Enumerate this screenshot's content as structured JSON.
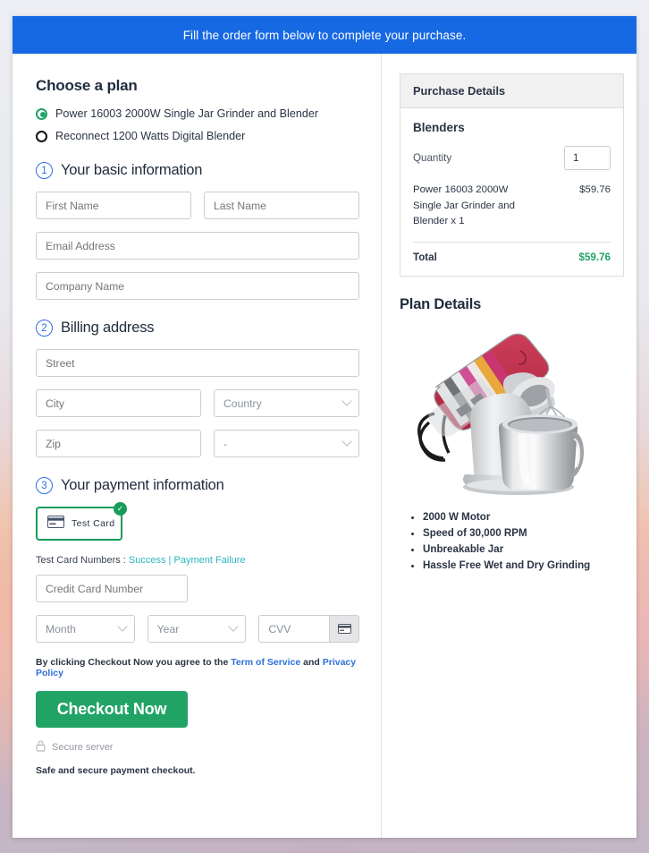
{
  "banner": {
    "text": "Fill the order form below to complete your purchase."
  },
  "plan": {
    "heading": "Choose a plan",
    "options": [
      {
        "label": "Power 16003 2000W Single Jar Grinder and Blender",
        "selected": true
      },
      {
        "label": "Reconnect 1200 Watts Digital Blender",
        "selected": false
      }
    ]
  },
  "step1": {
    "number": "1",
    "title": "Your basic information",
    "first_name_placeholder": "First Name",
    "last_name_placeholder": "Last Name",
    "email_placeholder": "Email Address",
    "company_placeholder": "Company Name"
  },
  "step2": {
    "number": "2",
    "title": "Billing address",
    "street_placeholder": "Street",
    "city_placeholder": "City",
    "country_placeholder": "Country",
    "zip_placeholder": "Zip",
    "state_placeholder": "-"
  },
  "step3": {
    "number": "3",
    "title": "Your payment information",
    "card_method_label": "Test  Card",
    "check_glyph": "✓",
    "test_numbers_label": "Test Card Numbers : ",
    "test_success": "Success",
    "test_separator": " | ",
    "test_failure": "Payment Failure",
    "card_number_placeholder": "Credit Card Number",
    "month_placeholder": "Month",
    "year_placeholder": "Year",
    "cvv_placeholder": "CVV"
  },
  "footer": {
    "terms_prefix": "By clicking Checkout Now you agree to the ",
    "terms_link": "Term of Service",
    "terms_mid": " and ",
    "privacy_link": "Privacy Policy",
    "checkout_label": "Checkout Now",
    "secure_label": "Secure server",
    "safe_label": "Safe and secure payment checkout."
  },
  "purchase": {
    "header": "Purchase Details",
    "category": "Blenders",
    "quantity_label": "Quantity",
    "quantity_value": "1",
    "item_name": "Power 16003 2000W Single Jar Grinder and Blender x 1",
    "item_price": "$59.76",
    "total_label": "Total",
    "total_value": "$59.76"
  },
  "plan_details": {
    "title": "Plan Details",
    "features": [
      "2000 W Motor",
      "Speed of 30,000 RPM",
      "Unbreakable Jar",
      "Hassle Free Wet and Dry Grinding"
    ]
  },
  "colors": {
    "banner_blue": "#1668e3",
    "accent_green": "#21a366",
    "link_blue": "#2f6fdb",
    "link_teal": "#2ab5c4",
    "step_blue": "#2f6fdb"
  }
}
